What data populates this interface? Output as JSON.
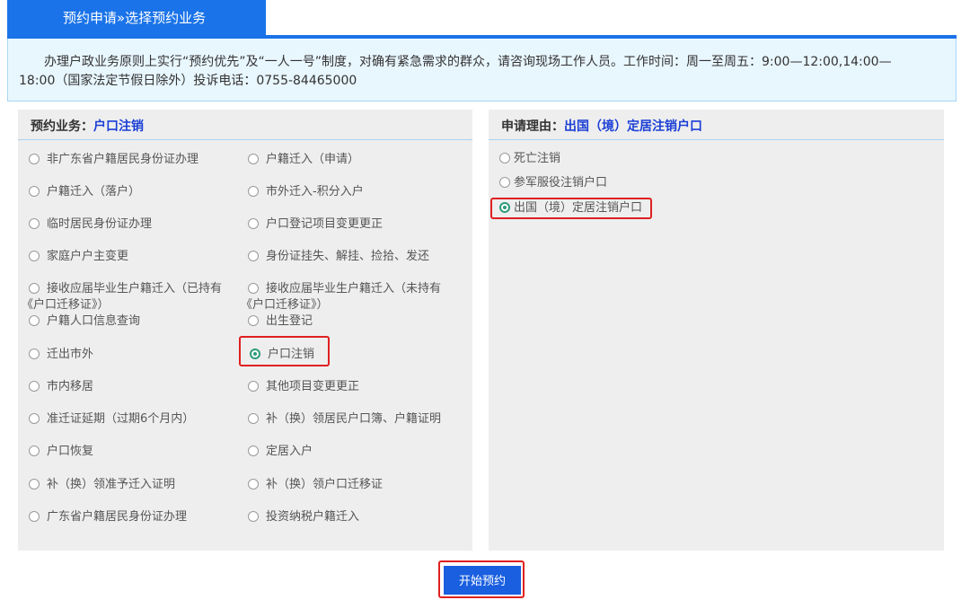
{
  "tab": {
    "title": "预约申请»选择预约业务"
  },
  "notice": {
    "line1": "办理户政业务原则上实行“预约优先”及“一人一号”制度，对确有紧急需求的群众，请咨询现场工作人员。工作时间：周一至周五：9:00—12:00,14:00—",
    "line2": "18:00（国家法定节假日除外）投诉电话：0755-84465000"
  },
  "business": {
    "label": "预约业务：",
    "selected": "户口注销",
    "options": [
      "非广东省户籍居民身份证办理",
      "户籍迁入（申请）",
      "户籍迁入（落户）",
      "市外迁入-积分入户",
      "临时居民身份证办理",
      "户口登记项目变更更正",
      "家庭户户主变更",
      "身份证挂失、解挂、捡拾、发还",
      "接收应届毕业生户籍迁入（已持有《户口迁移证》）",
      "接收应届毕业生户籍迁入（未持有《户口迁移证》）",
      "户籍人口信息查询",
      "出生登记",
      "迁出市外",
      "户口注销",
      "市内移居",
      "其他项目变更更正",
      "准迁证延期（过期6个月内）",
      "补（换）领居民户口簿、户籍证明",
      "户口恢复",
      "定居入户",
      "补（换）领准予迁入证明",
      "补（换）领户口迁移证",
      "广东省户籍居民身份证办理",
      "投资纳税户籍迁入"
    ]
  },
  "reason": {
    "label": "申请理由：",
    "selected": "出国（境）定居注销户口",
    "options": [
      "死亡注销",
      "参军服役注销户口",
      "出国（境）定居注销户口"
    ]
  },
  "button": {
    "start": "开始预约"
  },
  "colors": {
    "accent": "#1a73e8",
    "highlight": "#e02020",
    "radio_selected": "#2f9a7a"
  }
}
